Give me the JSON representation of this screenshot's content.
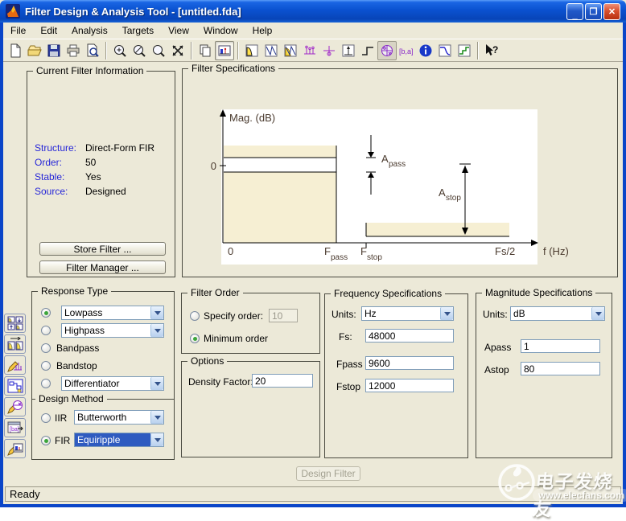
{
  "window": {
    "title": "Filter Design & Analysis Tool - [untitled.fda]"
  },
  "menu": {
    "items": [
      "File",
      "Edit",
      "Analysis",
      "Targets",
      "View",
      "Window",
      "Help"
    ]
  },
  "toolbar": {
    "icons": [
      "new-file",
      "open-file",
      "save",
      "print",
      "print-preview",
      "zoom-in",
      "zoom-out",
      "zoom-default",
      "full-view",
      "print-to-figure",
      "fdatool-design",
      "magnitude-response",
      "phase-response",
      "magnitude-phase-response",
      "group-delay",
      "phase-delay",
      "impulse-response",
      "step-response",
      "pole-zero-plot",
      "filter-coefficients",
      "filter-info",
      "filter-specifications",
      "realize-model",
      "context-help"
    ],
    "coef_glyph": "[b,a]",
    "help_glyph": "?"
  },
  "current_filter_info": {
    "title": "Current Filter Information",
    "fields": [
      {
        "label": "Structure:",
        "value": "Direct-Form FIR"
      },
      {
        "label": "Order:",
        "value": "50"
      },
      {
        "label": "Stable:",
        "value": "Yes"
      },
      {
        "label": "Source:",
        "value": "Designed"
      }
    ],
    "store_button": "Store Filter ...",
    "manager_button": "Filter Manager ..."
  },
  "filter_specifications": {
    "title": "Filter Specifications",
    "ylabel": "Mag. (dB)",
    "yzero": "0",
    "x0": "0",
    "fpass": {
      "main": "F",
      "sub": "pass"
    },
    "fstop": {
      "main": "F",
      "sub": "stop"
    },
    "fs2": "Fs/2",
    "xlabel": "f (Hz)",
    "apass": {
      "main": "A",
      "sub": "pass"
    },
    "astop": {
      "main": "A",
      "sub": "stop"
    }
  },
  "response_type": {
    "title": "Response Type",
    "lowpass": "Lowpass",
    "highpass": "Highpass",
    "bandpass": "Bandpass",
    "bandstop": "Bandstop",
    "differentiator": "Differentiator",
    "selected": "Lowpass"
  },
  "design_method": {
    "title": "Design Method",
    "iir_label": "IIR",
    "iir_value": "Butterworth",
    "fir_label": "FIR",
    "fir_value": "Equiripple",
    "selected": "FIR"
  },
  "filter_order": {
    "title": "Filter Order",
    "specify_label": "Specify order:",
    "specify_value": "10",
    "minimum_label": "Minimum order",
    "selected": "Minimum order"
  },
  "options": {
    "title": "Options",
    "density_label": "Density Factor:",
    "density_value": "20"
  },
  "frequency_specifications": {
    "title": "Frequency Specifications",
    "units_label": "Units:",
    "units_value": "Hz",
    "fs_label": "Fs:",
    "fs_value": "48000",
    "fpass_label": "Fpass",
    "fpass_value": "9600",
    "fstop_label": "Fstop",
    "fstop_value": "12000"
  },
  "magnitude_specifications": {
    "title": "Magnitude Specifications",
    "units_label": "Units:",
    "units_value": "dB",
    "apass_label": "Apass",
    "apass_value": "1",
    "astop_label": "Astop",
    "astop_value": "80"
  },
  "design_filter_button": "Design Filter",
  "status_bar": "Ready",
  "sidebar": {
    "icons": [
      "quantization",
      "transform-filter",
      "multirate-filter",
      "realize-model",
      "pole-zero-editor",
      "import-filter",
      "design-filter"
    ]
  },
  "watermark": {
    "site_name": "电子发烧友",
    "site_url": "www.elecfans.com"
  },
  "colors": {
    "titlebar_blue": "#0a51d0",
    "selection_blue": "#2f5bc0",
    "spec_fill": "#f6efd3",
    "info_label_blue": "#2626d8",
    "beige": "#ece9d8"
  }
}
